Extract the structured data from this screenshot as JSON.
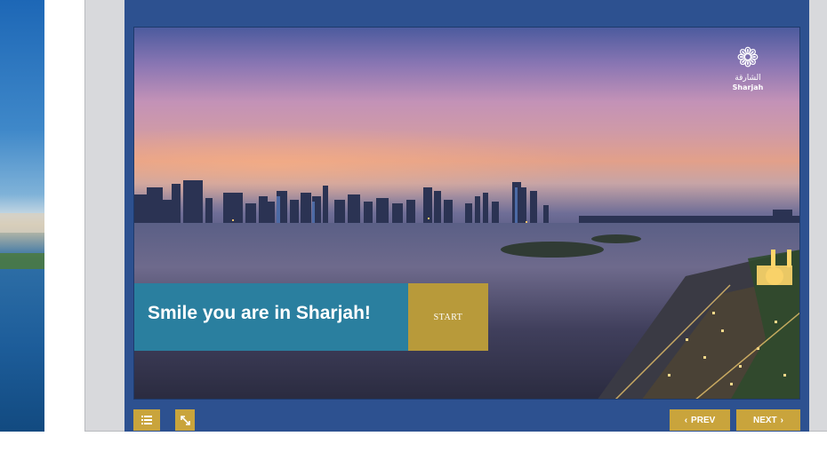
{
  "slide": {
    "headline": "Smile you are in Sharjah!",
    "start_label": "START",
    "logo": {
      "arabic": "الشارقة",
      "english": "Sharjah"
    }
  },
  "controls": {
    "prev_label": "PREV",
    "next_label": "NEXT"
  },
  "icons": {
    "menu": "list-icon",
    "expand": "expand-icon",
    "prev": "chevron-left-icon",
    "next": "chevron-right-icon",
    "logo": "sharjah-logo-icon"
  },
  "colors": {
    "player_frame": "#2d5190",
    "accent_gold": "#c9a43c",
    "banner_teal": "#2a7f9f",
    "start_gold": "#b89a3a",
    "outer_frame": "#d8d9dc"
  }
}
